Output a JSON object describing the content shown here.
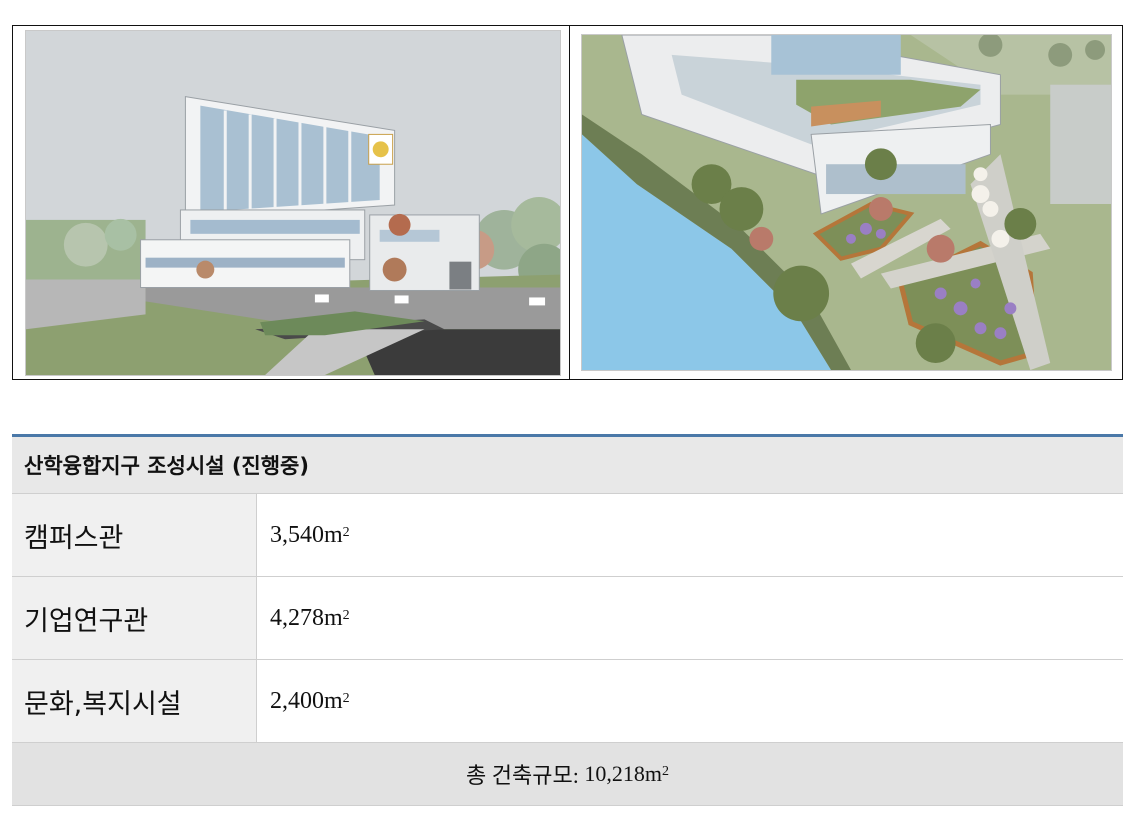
{
  "section": {
    "title": "산학융합지구 조성시설 (진행중)"
  },
  "facilities": [
    {
      "name": "캠퍼스관",
      "area_value": "3,540m",
      "area_sup": "2"
    },
    {
      "name": "기업연구관",
      "area_value": "4,278m",
      "area_sup": "2"
    },
    {
      "name": "문화,복지시설",
      "area_value": "2,400m",
      "area_sup": "2"
    }
  ],
  "total": {
    "label": "총 건축규모:",
    "value": "10,218m",
    "sup": "2"
  },
  "colors": {
    "accent_border": "#4a78a8",
    "header_bg": "#e8e8e8",
    "label_bg": "#f0f0f0",
    "footer_bg": "#e2e2e2"
  }
}
